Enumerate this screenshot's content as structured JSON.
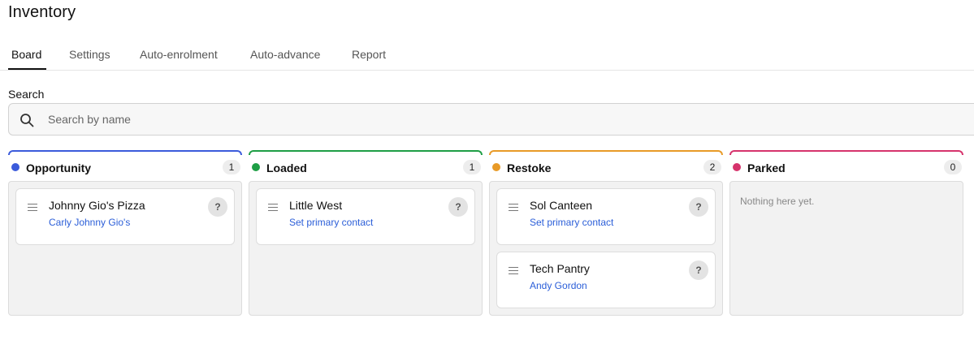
{
  "page": {
    "title": "Inventory"
  },
  "tabs": [
    {
      "label": "Board",
      "active": true
    },
    {
      "label": "Settings",
      "active": false
    },
    {
      "label": "Auto-enrolment",
      "active": false
    },
    {
      "label": "Auto-advance",
      "active": false
    },
    {
      "label": "Report",
      "active": false
    }
  ],
  "search": {
    "label": "Search",
    "placeholder": "Search by name",
    "value": ""
  },
  "columns": [
    {
      "title": "Opportunity",
      "count": "1",
      "color": "#3b5bdb",
      "cards": [
        {
          "name": "Johnny Gio's Pizza",
          "contact": "Carly Johnny Gio's",
          "help": "?"
        }
      ]
    },
    {
      "title": "Loaded",
      "count": "1",
      "color": "#1e9e45",
      "cards": [
        {
          "name": "Little West",
          "contact": "Set primary contact",
          "help": "?"
        }
      ]
    },
    {
      "title": "Restoke",
      "count": "2",
      "color": "#e89a27",
      "cards": [
        {
          "name": "Sol Canteen",
          "contact": "Set primary contact",
          "help": "?"
        },
        {
          "name": "Tech Pantry",
          "contact": "Andy Gordon",
          "help": "?"
        }
      ]
    },
    {
      "title": "Parked",
      "count": "0",
      "color": "#d6336c",
      "empty_text": "Nothing here yet.",
      "cards": []
    }
  ],
  "colors": {
    "link": "#2b5ed8",
    "column_bg": "#f2f2f2"
  },
  "icons": {
    "search": "search-icon",
    "drag": "drag-handle-icon"
  }
}
